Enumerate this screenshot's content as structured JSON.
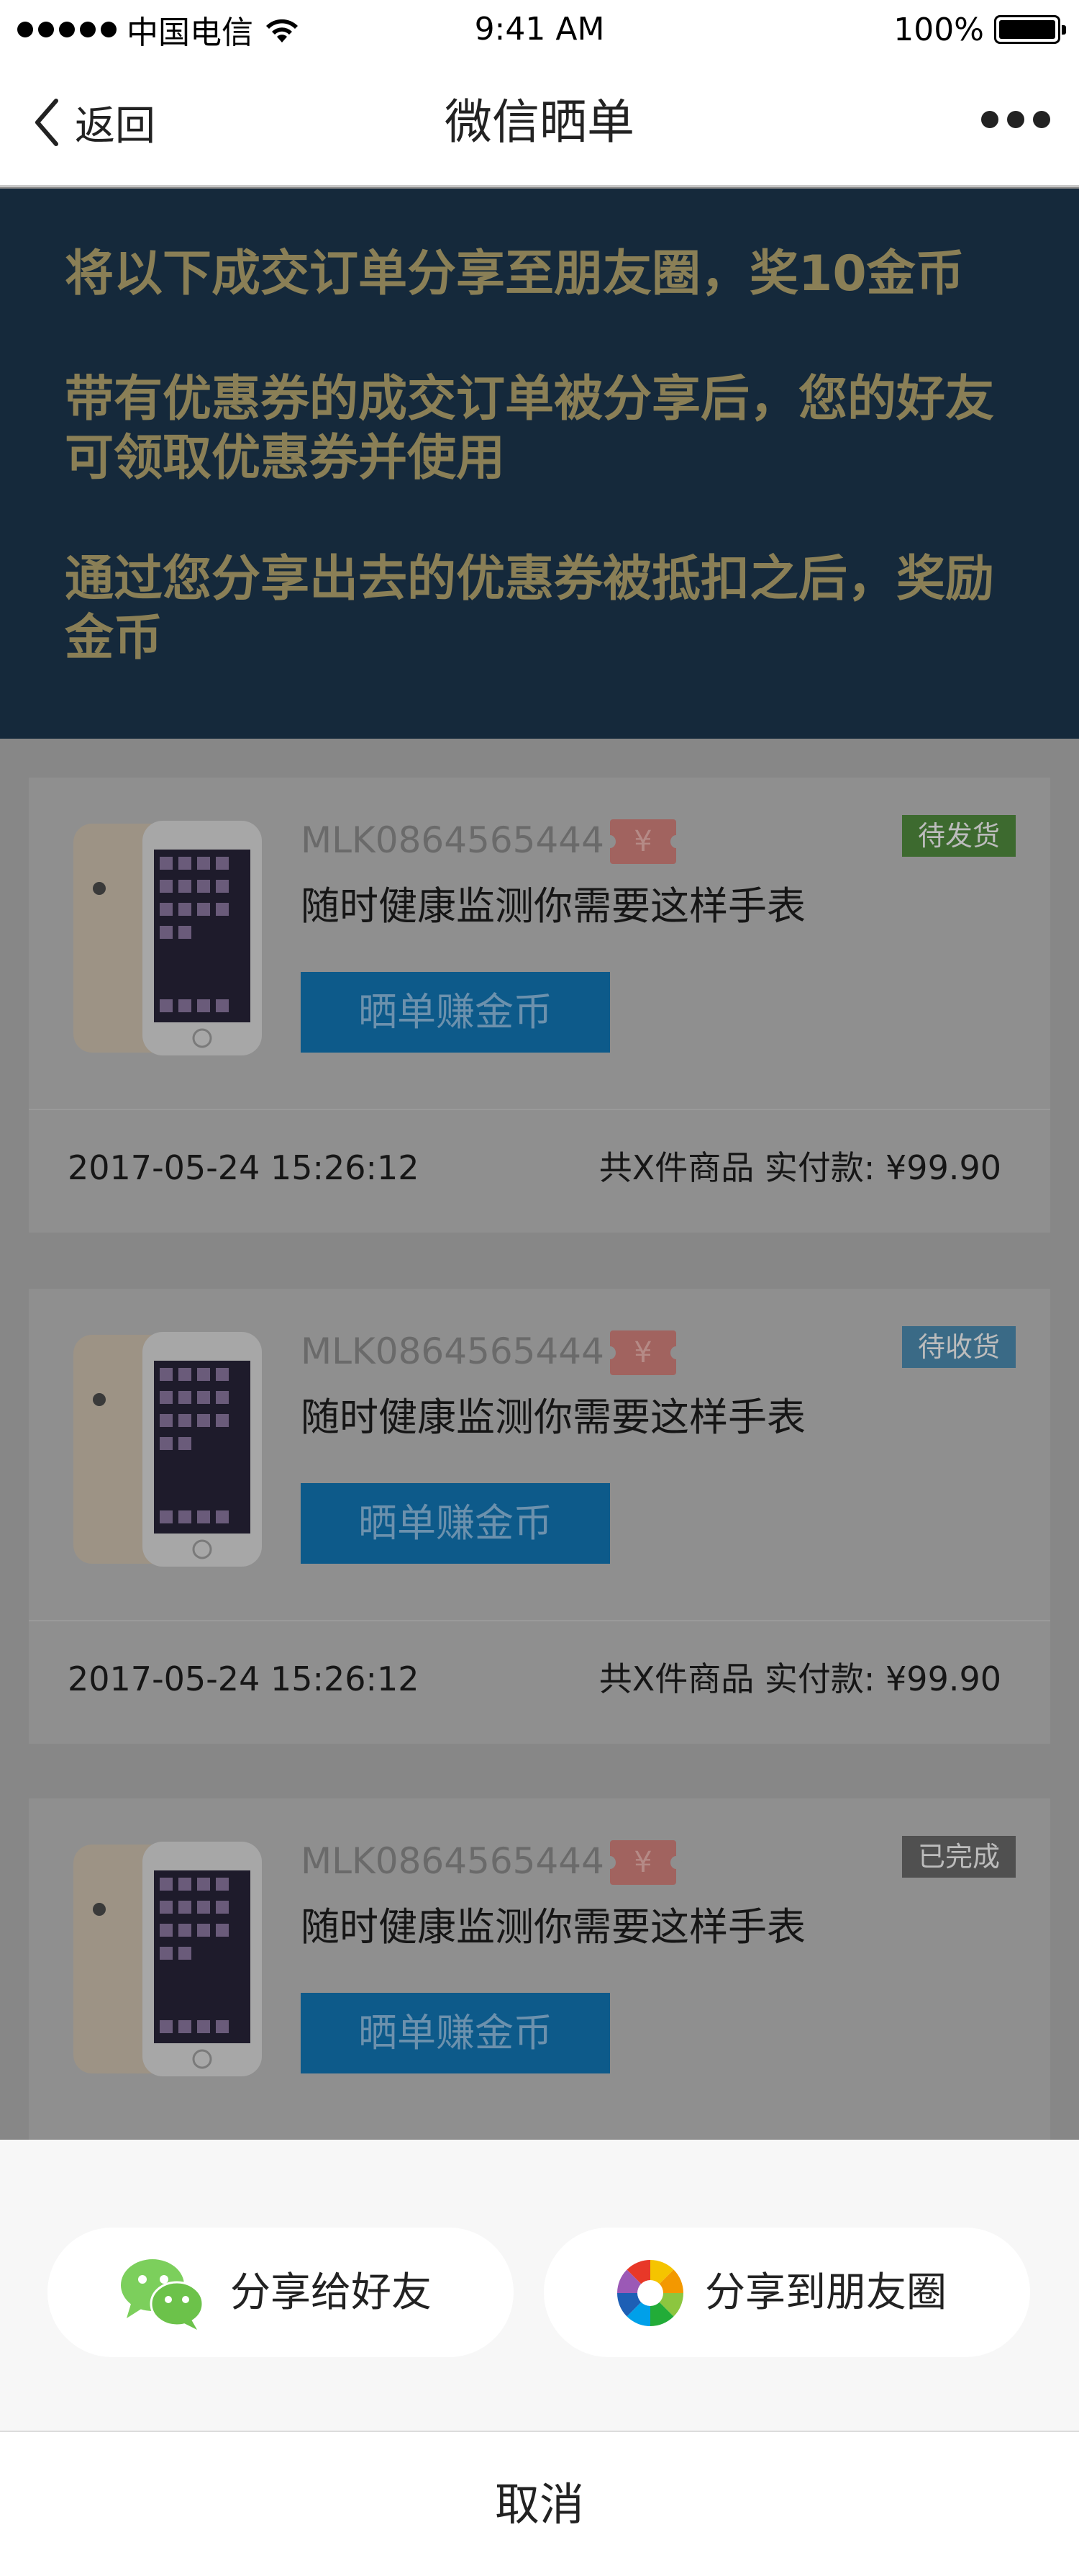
{
  "status_bar": {
    "carrier": "中国电信",
    "time": "9:41 AM",
    "battery": "100%"
  },
  "nav": {
    "back_label": "返回",
    "title": "微信晒单"
  },
  "banner": {
    "lines": [
      "将以下成交订单分享至朋友圈，奖10金币",
      "带有优惠券的成交订单被分享后，您的好友可领取优惠券并使用",
      "通过您分享出去的优惠券被抵扣之后，奖励金币"
    ]
  },
  "orders": [
    {
      "order_no": "MLK0864565444",
      "coupon": "¥",
      "status": "待发货",
      "status_color": "#3d6a2f",
      "product": "随时健康监测你需要这样手表",
      "button": "晒单赚金币",
      "date": "2017-05-24 15:26:12",
      "total": "共X件商品  实付款: ¥99.90"
    },
    {
      "order_no": "MLK0864565444",
      "coupon": "¥",
      "status": "待收货",
      "status_color": "#3a6a86",
      "product": "随时健康监测你需要这样手表",
      "button": "晒单赚金币",
      "date": "2017-05-24 15:26:12",
      "total": "共X件商品  实付款: ¥99.90"
    },
    {
      "order_no": "MLK0864565444",
      "coupon": "¥",
      "status": "已完成",
      "status_color": "#505050",
      "product": "随时健康监测你需要这样手表",
      "button": "晒单赚金币"
    }
  ],
  "share_sheet": {
    "friend_label": "分享给好友",
    "moments_label": "分享到朋友圈",
    "cancel_label": "取消"
  }
}
